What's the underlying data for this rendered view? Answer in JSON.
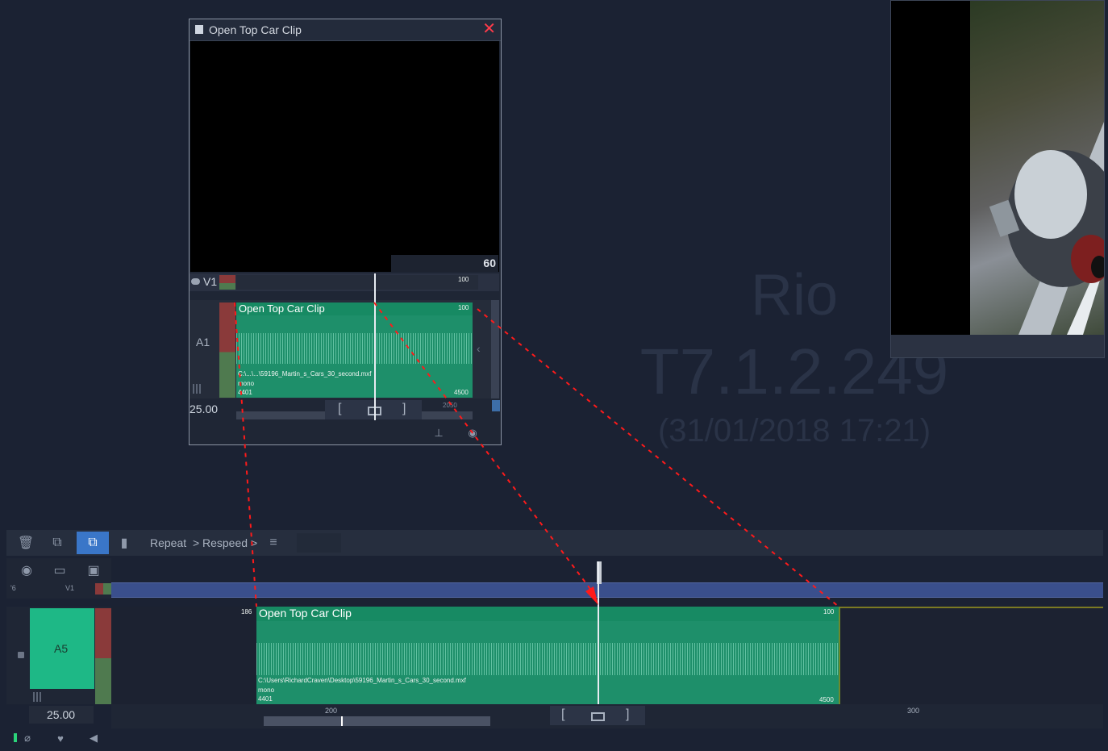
{
  "app": {
    "watermark_product": "Rio",
    "watermark_version": "T7.1.2.249",
    "watermark_date": "(31/01/2018 17:21)"
  },
  "clip_window": {
    "title": "Open Top Car Clip",
    "timecode": "60",
    "track_v1": "V1",
    "v1_value": "100",
    "track_a1": "A1",
    "clip_name": "Open Top Car Clip",
    "clip_level": "100",
    "clip_path": "C:\\...\\...\\59196_Martin_s_Cars_30_second.mxf",
    "clip_channels": "mono",
    "clip_start": "4401",
    "clip_end": "4500",
    "ruler_value": "2050",
    "fps": "25.00",
    "mark_in": "[",
    "mark_out": "]"
  },
  "toolbar": {
    "repeat_label": "Repeat",
    "respeed_label": "Respeed",
    "chevron": ">"
  },
  "timeline": {
    "track_v1": "V1",
    "track_number_left": "'6",
    "track_a5": "A5",
    "clip_name": "Open Top Car Clip",
    "clip_offset": "186",
    "clip_level": "100",
    "clip_path": "C:\\Users\\RichardCraven\\Desktop\\59196_Martin_s_Cars_30_second.mxf",
    "clip_channels": "mono",
    "clip_start": "4401",
    "clip_end": "4500",
    "fps": "25.00",
    "ruler_200": "200",
    "ruler_300": "300",
    "mark_in": "[",
    "mark_out": "]"
  }
}
